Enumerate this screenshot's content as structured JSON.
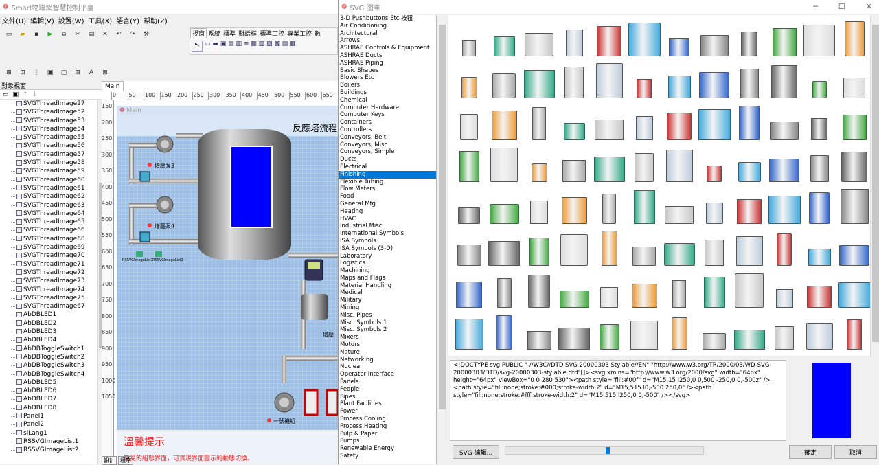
{
  "main": {
    "title": "Smart物聯網智慧控制平臺",
    "menu": [
      "文件(U)",
      "編輯(V)",
      "設置(W)",
      "工具(X)",
      "語言(Y)",
      "帮助(Z)"
    ],
    "palette_tabs": [
      "視窗",
      "系統",
      "標準",
      "對話框",
      "標準工控",
      "專業工控",
      "數"
    ],
    "tree_header": "對象視窗",
    "tree_items": [
      "SVGThreadImage27",
      "SVGThreadImage52",
      "SVGThreadImage53",
      "SVGThreadImage54",
      "SVGThreadImage55",
      "SVGThreadImage56",
      "SVGThreadImage57",
      "SVGThreadImage58",
      "SVGThreadImage59",
      "SVGThreadImage60",
      "SVGThreadImage61",
      "SVGThreadImage62",
      "SVGThreadImage63",
      "SVGThreadImage64",
      "SVGThreadImage65",
      "SVGThreadImage66",
      "SVGThreadImage68",
      "SVGThreadImage69",
      "SVGThreadImage70",
      "SVGThreadImage71",
      "SVGThreadImage72",
      "SVGThreadImage73",
      "SVGThreadImage74",
      "SVGThreadImage75",
      "SVGThreadImage67",
      "AbDBLED1",
      "AbDBLED2",
      "AbDBLED3",
      "AbDBLED4",
      "AbDBToggleSwitch1",
      "AbDBToggleSwitch2",
      "AbDBToggleSwitch3",
      "AbDBToggleSwitch4",
      "AbDBLED5",
      "AbDBLED6",
      "AbDBLED7",
      "AbDBLED8",
      "Panel1",
      "Panel2",
      "siLang1",
      "RSSVGImageList1",
      "RSSVGImageList2"
    ],
    "designer_tab": "Main",
    "ruler_h": [
      "0",
      "50",
      "100",
      "150",
      "200",
      "250",
      "300",
      "350",
      "400",
      "450",
      "500",
      "550",
      "600",
      "650"
    ],
    "ruler_v": [
      "150",
      "200",
      "250",
      "300",
      "350",
      "400",
      "450",
      "500",
      "550",
      "600",
      "650",
      "700",
      "750",
      "800",
      "850",
      "900",
      "950",
      "1000",
      "1050"
    ],
    "form_title": "Main",
    "process_title": "反應塔流程",
    "pump3": "增壓泵3",
    "pump4": "增壓泵4",
    "pump1": "一號機組",
    "pump_right": "增壓",
    "imglist1": "RSSVGImageList1",
    "imglist2": "RSSVGImageList2",
    "tip_title": "溫馨提示",
    "tip_text": "簡易的組態界面，可實現界面圖示的動態切換。",
    "bottom_tabs": [
      "設計",
      "程序"
    ]
  },
  "dialog": {
    "title": "SVG 图庫",
    "categories": [
      "3-D Pushbuttons Etc 按钮",
      "Air Conditioning",
      "Architectural",
      "Arrows",
      "ASHRAE Controls & Equipment",
      "ASHRAE Ducts",
      "ASHRAE Piping",
      "Basic Shapes",
      "Blowers Etc",
      "Boilers",
      "Buildings",
      "Chemical",
      "Computer Hardware",
      "Computer Keys",
      "Containers",
      "Controllers",
      "Conveyors, Belt",
      "Conveyors, Misc",
      "Conveyors, Simple",
      "Ducts",
      "Electrical",
      "Finishing",
      "Flexible Tubing",
      "Flow Meters",
      "Food",
      "General Mfg",
      "Heating",
      "HVAC",
      "Industrial Misc",
      "International Symbols",
      "ISA Symbols",
      "ISA Symbols (3-D)",
      "Laboratory",
      "Logistics",
      "Machining",
      "Maps and Flags",
      "Material Handling",
      "Medical",
      "Military",
      "Mining",
      "Misc. Pipes",
      "Misc. Symbols 1",
      "Misc. Symbols 2",
      "Mixers",
      "Motors",
      "Nature",
      "Networking",
      "Nuclear",
      "Operator Interface",
      "Panels",
      "People",
      "Pipes",
      "Plant Facilities",
      "Power",
      "Process Cooling",
      "Process Heating",
      "Pulp & Paper",
      "Pumps",
      "Renewable Energy",
      "Safety"
    ],
    "selected": "Finishing",
    "svg_code": "<!DOCTYPE svg PUBLIC \"-//W3C//DTD SVG 20000303 Stylable//EN\" \"http://www.w3.org/TR/2000/03/WD-SVG-20000303/DTD/svg-20000303-stylable.dtd\"[]><svg xmlns=\"http://www.w3.org/2000/svg\" width=\"64px\" height=\"64px\" viewBox=\"0 0 280 530\"><path style=\"fill:#00f\" d=\"M15,15 l250,0 0,500 -250,0 0,-500z\" /><path style=\"fill:none;stroke:#000;stroke-width:2\" d=\"M15,515 l0,-500 250,0\" /><path style=\"fill:none;stroke:#fff;stroke-width:2\" d=\"M15,515 l250,0 0,-500\" /></svg>",
    "edit_btn": "SVG 编辑...",
    "ok_btn": "確定",
    "cancel_btn": "取消",
    "colors": {
      "preview": "#0000ff",
      "selection": "#0078d7",
      "canvas": "#9dc0e8"
    }
  }
}
